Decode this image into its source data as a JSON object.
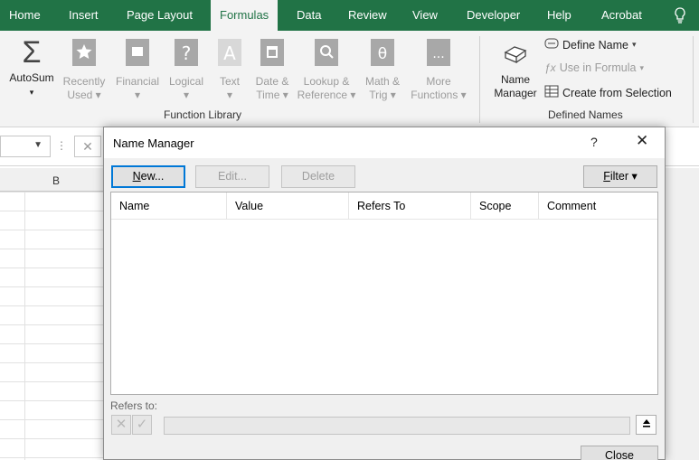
{
  "ribbon_tabs": [
    "Home",
    "Insert",
    "Page Layout",
    "Formulas",
    "Data",
    "Review",
    "View",
    "Developer",
    "Help",
    "Acrobat"
  ],
  "active_tab": "Formulas",
  "function_library": {
    "autosum": [
      "AutoSum",
      "▾"
    ],
    "recently_used": [
      "Recently",
      "Used ▾"
    ],
    "financial": [
      "Financial",
      "▾"
    ],
    "logical": [
      "Logical",
      "▾"
    ],
    "text": [
      "Text",
      "▾"
    ],
    "date_time": [
      "Date &",
      "Time ▾"
    ],
    "lookup": [
      "Lookup &",
      "Reference ▾"
    ],
    "math": [
      "Math &",
      "Trig ▾"
    ],
    "more": [
      "More",
      "Functions ▾"
    ],
    "label": "Function Library"
  },
  "defined_names": {
    "name_manager": [
      "Name",
      "Manager"
    ],
    "define_name": "Define Name",
    "use_in_formula": "Use in Formula",
    "create_from_selection": "Create from Selection",
    "label": "Defined Names"
  },
  "column_header": "B",
  "dialog": {
    "title": "Name Manager",
    "help": "?",
    "close_glyph": "✕",
    "new_label": "ew...",
    "new_mnemonic": "N",
    "edit_label": "Edit...",
    "delete_label": "Delete",
    "filter_label": "ilter ▾",
    "filter_mnemonic": "F",
    "columns": [
      "Name",
      "Value",
      "Refers To",
      "Scope",
      "Comment"
    ],
    "refers_to_label": "Refers to:",
    "close_label": "Close"
  },
  "colors": {
    "ribbon_green": "#217346",
    "ribbon_bg": "#f3f3f3",
    "accent_blue": "#0078d7"
  }
}
